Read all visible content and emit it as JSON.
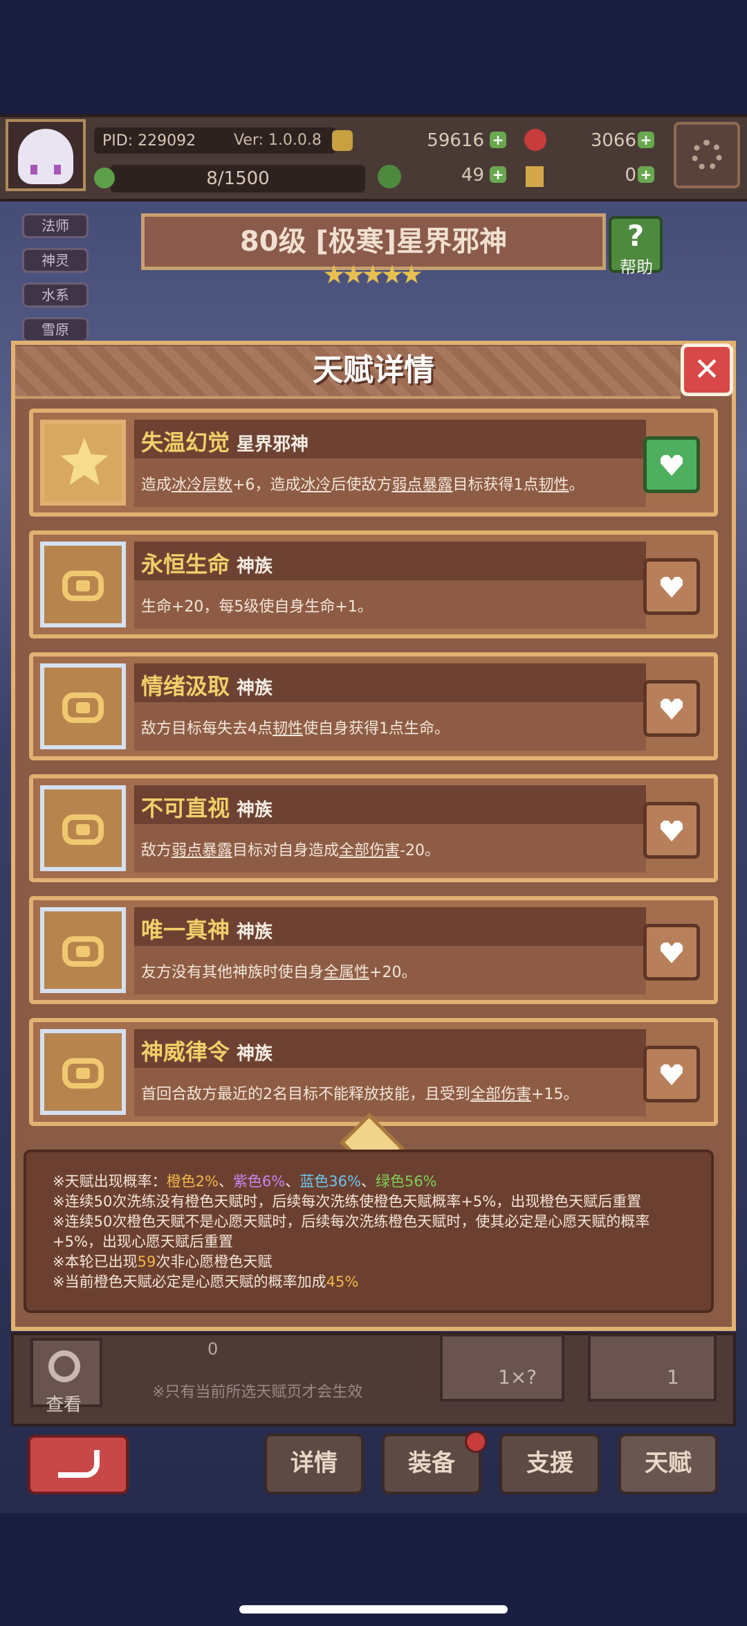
{
  "header": {
    "pid": "PID: 229092",
    "version": "Ver: 1.0.0.8",
    "exp": "8/1500",
    "currency_gold": "59616",
    "currency_red": "3066",
    "currency_clover": "49",
    "currency_key": "0"
  },
  "side_tags": [
    "法师",
    "神灵",
    "水系",
    "雪原"
  ],
  "boss": {
    "title": "80级 [极寒]星界邪神",
    "stars": 5,
    "help_label": "帮助"
  },
  "modal": {
    "title": "天赋详情",
    "close_label": "✕",
    "cards": [
      {
        "name": "失温幻觉",
        "sub": "星界邪神",
        "icon": "star-icon",
        "selected": true,
        "desc_parts": [
          {
            "t": "造成"
          },
          {
            "t": "冰冷层数",
            "u": true
          },
          {
            "t": "+6，造成"
          },
          {
            "t": "冰冷",
            "u": true
          },
          {
            "t": "后使敌方"
          },
          {
            "t": "弱点暴露",
            "u": true
          },
          {
            "t": "目标获得1点"
          },
          {
            "t": "韧性",
            "u": true
          },
          {
            "t": "。"
          }
        ]
      },
      {
        "name": "永恒生命",
        "sub": "神族",
        "icon": "emblem-icon",
        "selected": false,
        "desc_parts": [
          {
            "t": "生命+20，每5级使自身生命+1。"
          }
        ]
      },
      {
        "name": "情绪汲取",
        "sub": "神族",
        "icon": "emblem-icon",
        "selected": false,
        "desc_parts": [
          {
            "t": "敌方目标每失去4点"
          },
          {
            "t": "韧性",
            "u": true
          },
          {
            "t": "使自身获得1点生命。"
          }
        ]
      },
      {
        "name": "不可直视",
        "sub": "神族",
        "icon": "emblem-icon",
        "selected": false,
        "desc_parts": [
          {
            "t": "敌方"
          },
          {
            "t": "弱点暴露",
            "u": true
          },
          {
            "t": "目标对自身造成"
          },
          {
            "t": "全部伤害",
            "u": true
          },
          {
            "t": "-20。"
          }
        ]
      },
      {
        "name": "唯一真神",
        "sub": "神族",
        "icon": "emblem-icon",
        "selected": false,
        "desc_parts": [
          {
            "t": "友方没有其他神族时使自身"
          },
          {
            "t": "全属性",
            "u": true
          },
          {
            "t": "+20。"
          }
        ]
      },
      {
        "name": "神威律令",
        "sub": "神族",
        "icon": "emblem-icon",
        "selected": false,
        "desc_parts": [
          {
            "t": "首回合敌方最近的2名目标不能释放技能，且受到"
          },
          {
            "t": "全部伤害",
            "u": true
          },
          {
            "t": "+15。"
          }
        ]
      }
    ],
    "info": {
      "line1_prefix": "※天赋出现概率：",
      "line1_orange": "橙色2%",
      "line1_sep1": "、",
      "line1_purple": "紫色6%",
      "line1_sep2": "、",
      "line1_blue": "蓝色36%",
      "line1_sep3": "、",
      "line1_green": "绿色56%",
      "line2": "※连续50次洗练没有橙色天赋时，后续每次洗练使橙色天赋概率+5%，出现橙色天赋后重置",
      "line3": "※连续50次橙色天赋不是心愿天赋时，后续每次洗练橙色天赋时，使其必定是心愿天赋的概率",
      "line4": "+5%，出现心愿天赋后重置",
      "line5_prefix": "※本轮已出现",
      "line5_value": "59",
      "line5_suffix": "次非心愿橙色天赋",
      "line6_prefix": "※当前橙色天赋必定是心愿天赋的概率加成",
      "line6_value": "45%"
    }
  },
  "lower": {
    "count": "0",
    "view_label": "查看",
    "notice": "※只有当前所选天赋页才会生效",
    "auto_label": "1×?",
    "talent_refine_count": "1"
  },
  "bottom_nav": [
    "详情",
    "装备",
    "支援",
    "天赋"
  ]
}
